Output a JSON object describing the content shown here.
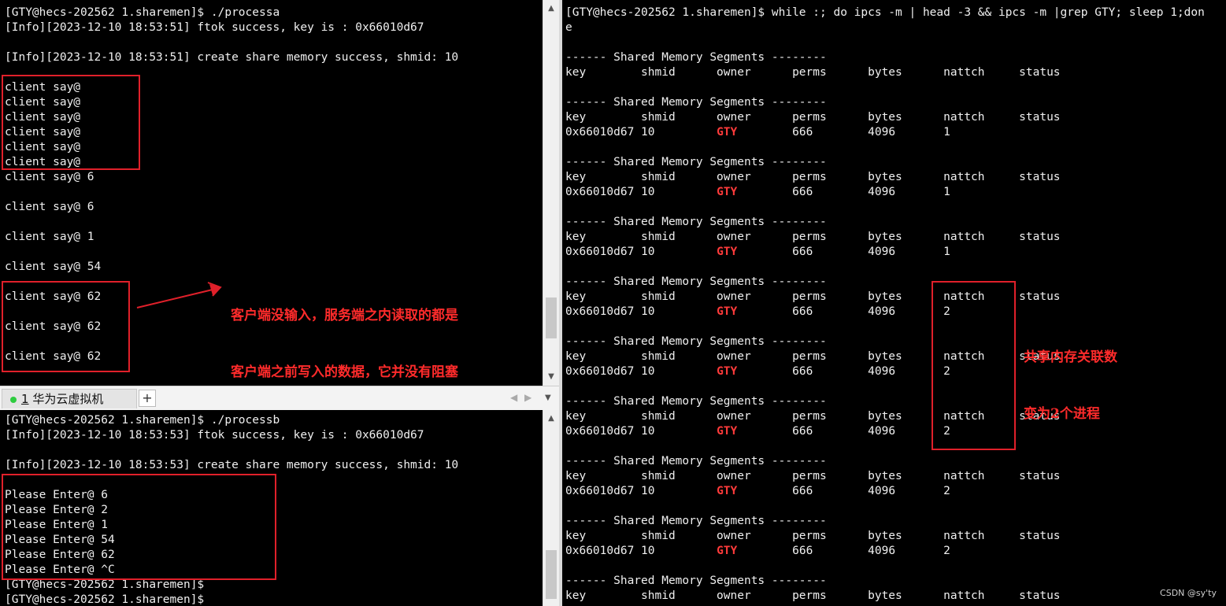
{
  "left_top": {
    "lines": [
      "[GTY@hecs-202562 1.sharemen]$ ./processa",
      "[Info][2023-12-10 18:53:51] ftok success, key is : 0x66010d67",
      "",
      "[Info][2023-12-10 18:53:51] create share memory success, shmid: 10",
      "",
      "client say@",
      "client say@",
      "client say@",
      "client say@",
      "client say@",
      "client say@",
      "client say@ 6",
      "",
      "client say@ 6",
      "",
      "client say@ 1",
      "",
      "client say@ 54",
      "",
      "client say@ 62",
      "",
      "client say@ 62",
      "",
      "client say@ 62"
    ]
  },
  "tab_bar": {
    "tab_number": "1",
    "tab_label": "华为云虚拟机",
    "new_tab": "+",
    "prev": "◀",
    "next": "▶",
    "menu": "▼"
  },
  "left_bottom": {
    "lines": [
      "[GTY@hecs-202562 1.sharemen]$ ./processb",
      "[Info][2023-12-10 18:53:53] ftok success, key is : 0x66010d67",
      "",
      "[Info][2023-12-10 18:53:53] create share memory success, shmid: 10",
      "",
      "Please Enter@ 6",
      "Please Enter@ 2",
      "Please Enter@ 1",
      "Please Enter@ 54",
      "Please Enter@ 62",
      "Please Enter@ ^C",
      "[GTY@hecs-202562 1.sharemen]$",
      "[GTY@hecs-202562 1.sharemen]$"
    ]
  },
  "right": {
    "command_1": "[GTY@hecs-202562 1.sharemen]$ while :; do ipcs -m | head -3 && ipcs -m |grep GTY; sleep 1;don",
    "command_2": "e",
    "segment_header": "------ Shared Memory Segments --------",
    "columns": "key        shmid      owner      perms      bytes      nattch     status",
    "row_key": "0x66010d67 10         ",
    "row_owner": "GTY",
    "row_tail_1": "        666        4096       1",
    "row_tail_2": "        666        4096       2",
    "blocks": [
      {
        "nattch": "none"
      },
      {
        "nattch": "1"
      },
      {
        "nattch": "1"
      },
      {
        "nattch": "1"
      },
      {
        "nattch": "2"
      },
      {
        "nattch": "2"
      },
      {
        "nattch": "2"
      },
      {
        "nattch": "2"
      },
      {
        "nattch": "2"
      },
      {
        "nattch": "partial"
      }
    ]
  },
  "annotations": {
    "left_note_line1": "客户端没输入，服务端之内读取的都是",
    "left_note_line2": "客户端之前写入的数据，它并没有阻塞",
    "right_note_line1": "共享内存关联数",
    "right_note_line2": "变为2个进程"
  },
  "watermark": "CSDN @sy'ty",
  "colors": {
    "terminal_bg": "#000000",
    "terminal_fg": "#f0f0f0",
    "owner_highlight": "#ff3b3b",
    "annotation": "#ff2b2b"
  }
}
